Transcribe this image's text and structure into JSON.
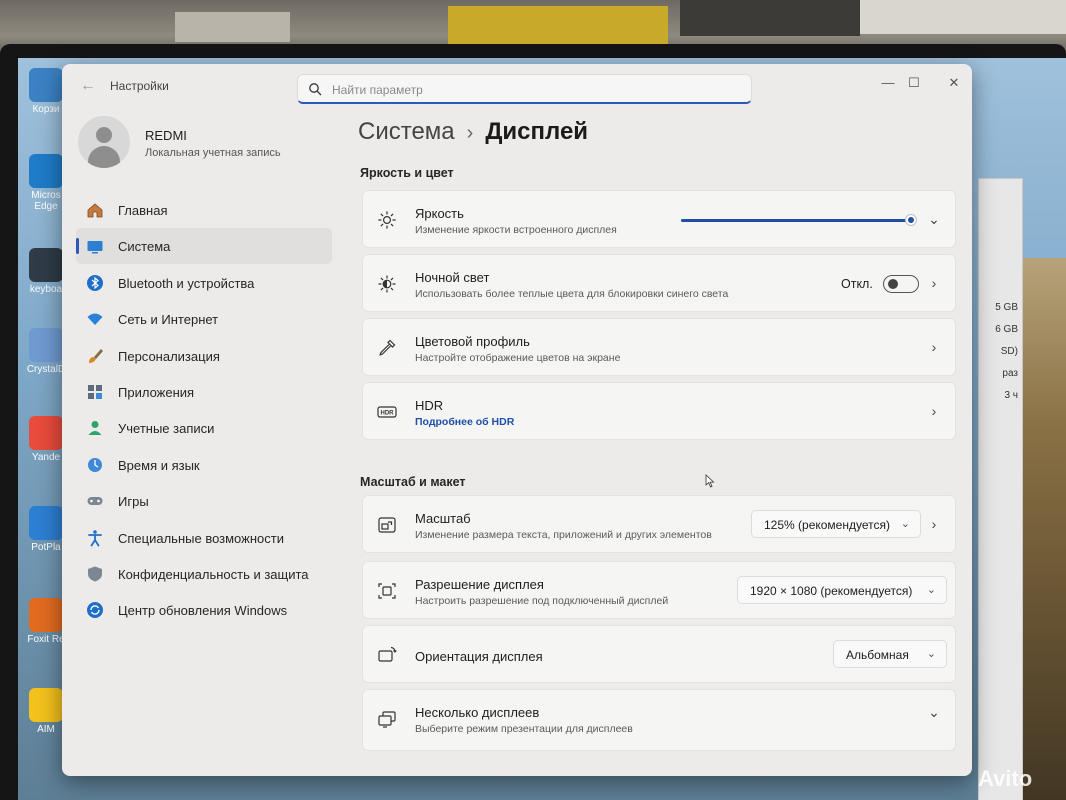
{
  "desktop": {
    "icons": [
      {
        "label": "Корзи",
        "color": "#3b82c4"
      },
      {
        "label": "Micros Edge",
        "color": "#1e7cc8"
      },
      {
        "label": "keyboa",
        "color": "#2f3b46"
      },
      {
        "label": "CrystalD",
        "color": "#6f9ad0"
      },
      {
        "label": "Yande",
        "color": "#e94b3c"
      },
      {
        "label": "PotPla",
        "color": "#2d7fd3"
      },
      {
        "label": "Foxit Re",
        "color": "#e36b1f"
      },
      {
        "label": "AIM",
        "color": "#f3c21c"
      }
    ],
    "bg_window_rows": [
      "5 GB",
      "6 GB",
      "SD)",
      "раз",
      "3 ч"
    ],
    "watermark": "Avito"
  },
  "window": {
    "title": "Настройки",
    "search_placeholder": "Найти параметр",
    "controls": {
      "minimize": "—",
      "maximize": "☐",
      "close": "✕"
    }
  },
  "profile": {
    "name": "REDMI",
    "account_type": "Локальная учетная запись"
  },
  "nav": [
    {
      "label": "Главная",
      "icon": "home-icon",
      "active": false
    },
    {
      "label": "Система",
      "icon": "system-icon",
      "active": true
    },
    {
      "label": "Bluetooth и устройства",
      "icon": "bluetooth-icon",
      "active": false
    },
    {
      "label": "Сеть и Интернет",
      "icon": "network-icon",
      "active": false
    },
    {
      "label": "Персонализация",
      "icon": "brush-icon",
      "active": false
    },
    {
      "label": "Приложения",
      "icon": "apps-icon",
      "active": false
    },
    {
      "label": "Учетные записи",
      "icon": "accounts-icon",
      "active": false
    },
    {
      "label": "Время и язык",
      "icon": "globe-clock-icon",
      "active": false
    },
    {
      "label": "Игры",
      "icon": "gamepad-icon",
      "active": false
    },
    {
      "label": "Специальные возможности",
      "icon": "accessibility-icon",
      "active": false
    },
    {
      "label": "Конфиденциальность и защита",
      "icon": "shield-icon",
      "active": false
    },
    {
      "label": "Центр обновления Windows",
      "icon": "update-icon",
      "active": false
    }
  ],
  "breadcrumb": {
    "parent": "Система",
    "separator": "›",
    "current": "Дисплей"
  },
  "sections": {
    "brightness_color": "Яркость и цвет",
    "scale_layout": "Масштаб и макет"
  },
  "cards": {
    "brightness": {
      "title": "Яркость",
      "subtitle": "Изменение яркости встроенного дисплея",
      "level": 0.99
    },
    "night_light": {
      "title": "Ночной свет",
      "subtitle": "Использовать более теплые цвета для блокировки синего света",
      "state_label": "Откл.",
      "on": false
    },
    "color_profile": {
      "title": "Цветовой профиль",
      "subtitle": "Настройте отображение цветов на экране"
    },
    "hdr": {
      "title": "HDR",
      "link": "Подробнее об HDR",
      "icon_text": "HDR"
    },
    "scale": {
      "title": "Масштаб",
      "subtitle": "Изменение размера текста, приложений и других элементов",
      "value": "125% (рекомендуется)"
    },
    "resolution": {
      "title": "Разрешение дисплея",
      "subtitle": "Настроить разрешение под подключенный дисплей",
      "value": "1920 × 1080 (рекомендуется)"
    },
    "orientation": {
      "title": "Ориентация дисплея",
      "value": "Альбомная"
    },
    "multi": {
      "title": "Несколько дисплеев",
      "subtitle": "Выберите режим презентации для дисплеев"
    }
  },
  "colors": {
    "accent": "#1f4fa8",
    "window_bg": "#ecebea",
    "card_bg": "#f5f5f4"
  }
}
